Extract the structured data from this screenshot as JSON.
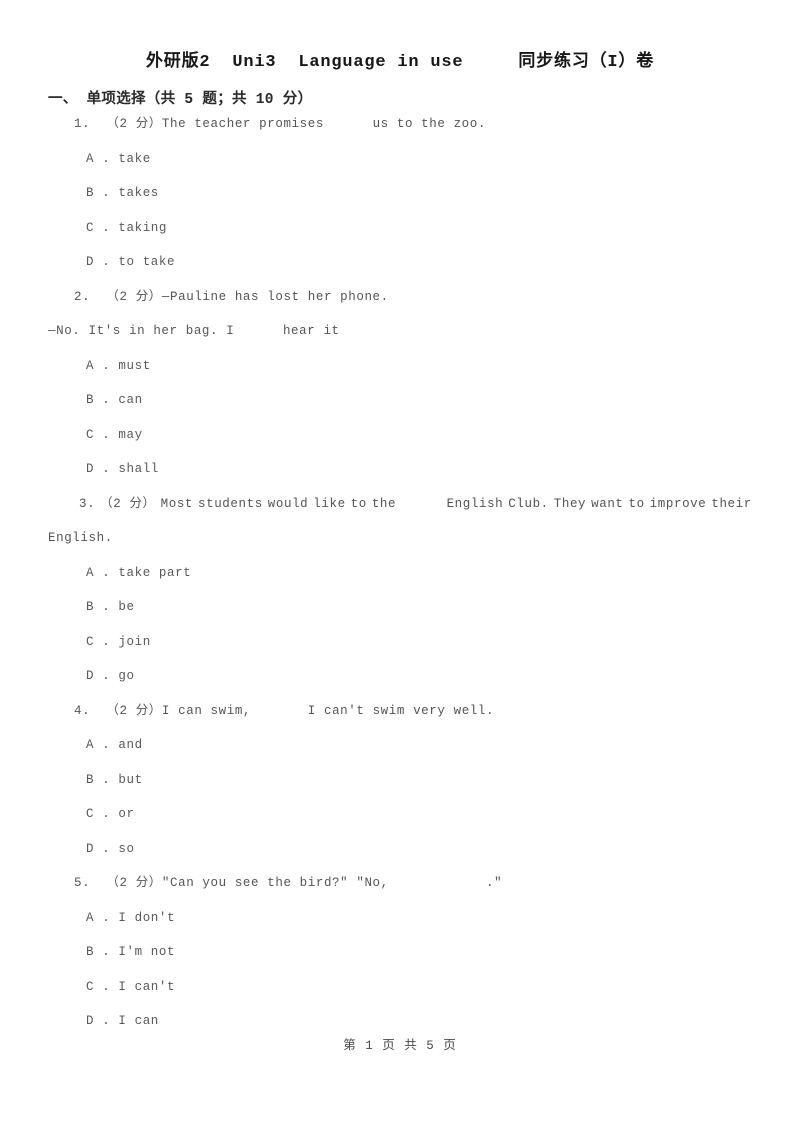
{
  "document": {
    "title": "外研版2  Uni3  Language in use     同步练习（I）卷",
    "section_heading": "一、 单项选择（共 5 题；共 10 分）",
    "footer": "第 1 页 共 5 页"
  },
  "questions": [
    {
      "number": "1.",
      "points": "（2 分）",
      "stem": "The teacher promises",
      "stem_after_blank": "us to the zoo.",
      "options": [
        "A . take",
        "B . takes",
        "C . taking",
        "D . to take"
      ]
    },
    {
      "number": "2.",
      "points": "（2 分）",
      "stem": "—Pauline has lost her phone.",
      "stem_line2_before_blank": "—No. It's in her bag. I",
      "stem_line2_after_blank": "hear it",
      "options": [
        "A . must",
        "B . can",
        "C . may",
        "D . shall"
      ]
    },
    {
      "number": "3.",
      "points": "（2 分）",
      "stem_words": [
        "Most",
        "students",
        "would",
        "like",
        "to",
        "the"
      ],
      "stem_words_after_blank": [
        "English",
        "Club.",
        "They",
        "want",
        "to",
        "improve",
        "their"
      ],
      "stem_line2": "English.",
      "options": [
        "A . take part",
        "B . be",
        "C . join",
        "D . go"
      ]
    },
    {
      "number": "4.",
      "points": "（2 分）",
      "stem": "I can swim,",
      "stem_after_blank": "I can't swim very well.",
      "options": [
        "A . and",
        "B . but",
        "C . or",
        "D . so"
      ]
    },
    {
      "number": "5.",
      "points": "（2 分）",
      "stem": "\"Can you see the bird?\" \"No,",
      "stem_after_blank": ".\"",
      "options": [
        "A . I don't",
        "B . I'm not",
        "C . I can't",
        "D . I can"
      ]
    }
  ]
}
